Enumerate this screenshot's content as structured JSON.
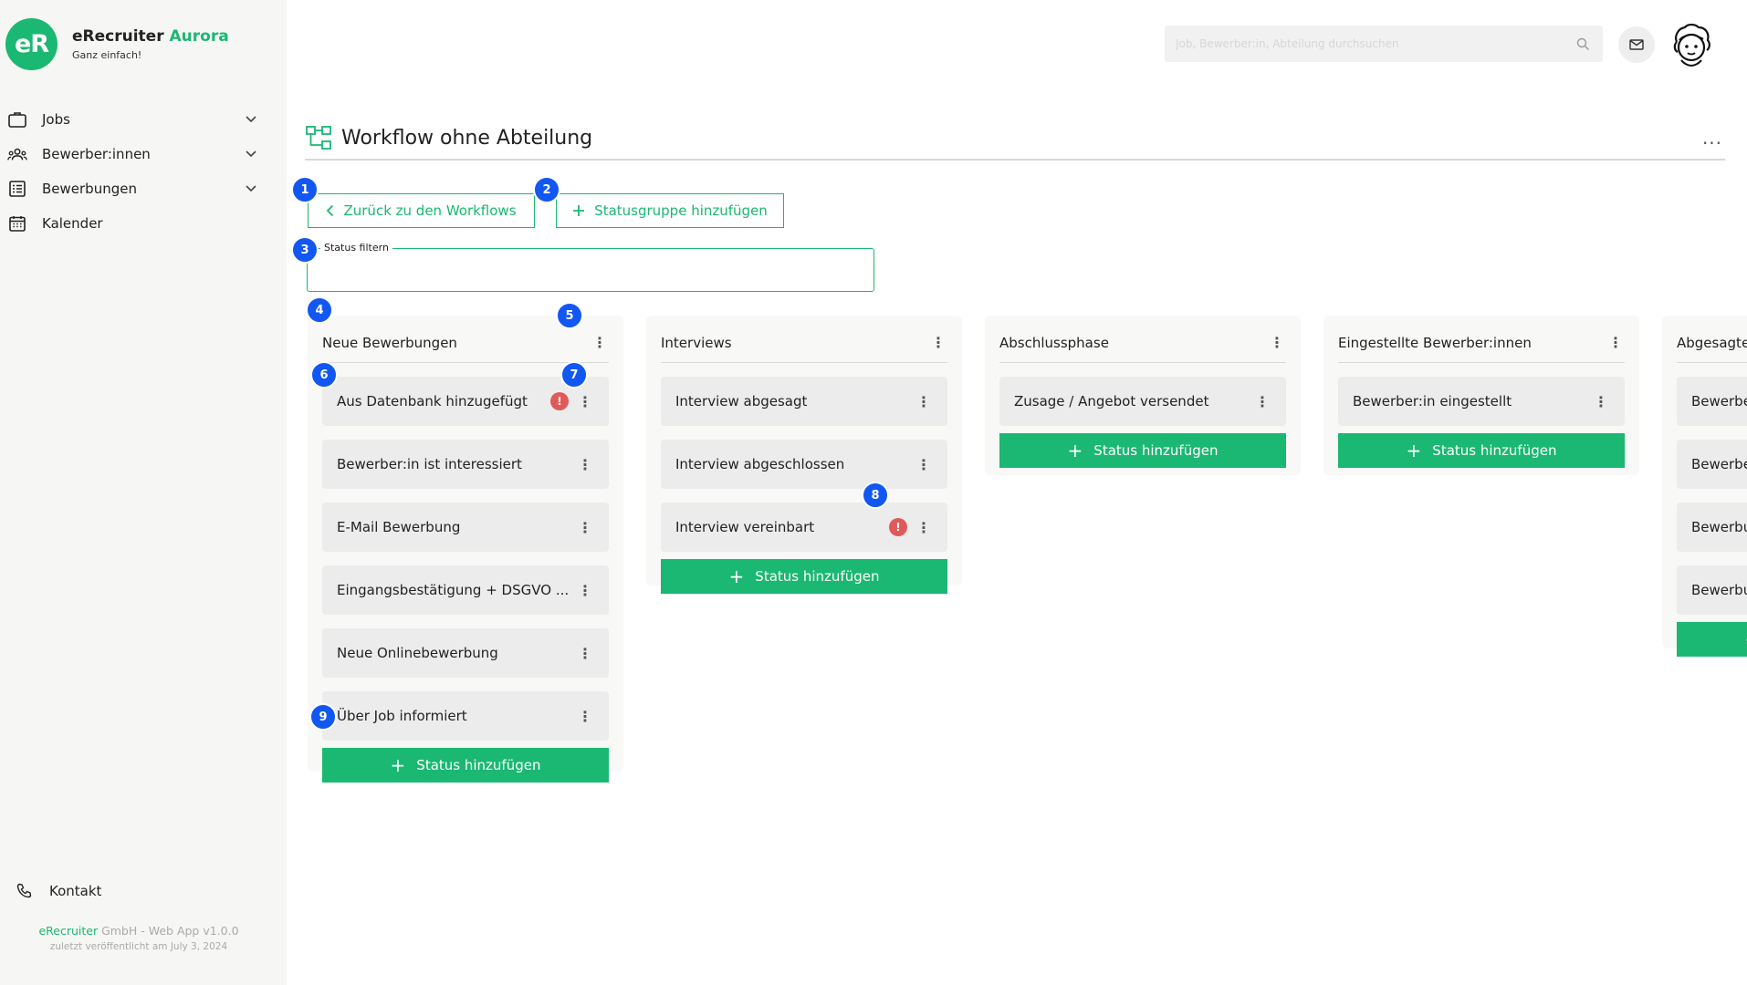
{
  "brand": {
    "logo_text": "eR",
    "name": "eRecruiter",
    "name_accent": "Aurora",
    "tagline": "Ganz einfach!",
    "accent_color": "#1ab872"
  },
  "sidebar": {
    "items": [
      {
        "label": "Jobs",
        "icon": "briefcase-icon",
        "has_chevron": true
      },
      {
        "label": "Bewerber:innen",
        "icon": "people-icon",
        "has_chevron": true
      },
      {
        "label": "Bewerbungen",
        "icon": "list-icon",
        "has_chevron": true
      },
      {
        "label": "Kalender",
        "icon": "calendar-icon",
        "has_chevron": false
      }
    ],
    "contact_label": "Kontakt",
    "footer_company": "eRecruiter",
    "footer_rest": " GmbH - Web App v1.0.0",
    "footer_published": "zuletzt veröffentlicht am July 3, 2024"
  },
  "topbar": {
    "search_placeholder": "Job, Bewerber:in, Abteilung durchsuchen"
  },
  "page": {
    "title": "Workflow ohne Abteilung",
    "more": "..."
  },
  "actions": {
    "back_label": "Zurück zu den Workflows",
    "add_group_label": "Statusgruppe hinzufügen"
  },
  "filter": {
    "legend": "Status filtern",
    "value": ""
  },
  "add_status_label": "Status hinzufügen",
  "columns": [
    {
      "title": "Neue Bewerbungen",
      "statuses": [
        {
          "label": "Aus Datenbank hinzugefügt",
          "warning": true
        },
        {
          "label": "Bewerber:in ist interessiert",
          "warning": false
        },
        {
          "label": "E-Mail Bewerbung",
          "warning": false
        },
        {
          "label": "Eingangsbestätigung + DSGVO ...",
          "warning": false
        },
        {
          "label": "Neue Onlinebewerbung",
          "warning": false
        },
        {
          "label": "Über Job informiert",
          "warning": false
        }
      ]
    },
    {
      "title": "Interviews",
      "statuses": [
        {
          "label": "Interview abgesagt",
          "warning": false
        },
        {
          "label": "Interview abgeschlossen",
          "warning": false
        },
        {
          "label": "Interview vereinbart",
          "warning": true
        }
      ]
    },
    {
      "title": "Abschlussphase",
      "statuses": [
        {
          "label": "Zusage / Angebot versendet",
          "warning": false
        }
      ]
    },
    {
      "title": "Eingestellte Bewerber:innen",
      "statuses": [
        {
          "label": "Bewerber:in eingestellt",
          "warning": false
        }
      ]
    },
    {
      "title": "Abgesagte Bewerber:innen",
      "statuses": [
        {
          "label": "Bewerber:in abgesagt",
          "warning": false
        },
        {
          "label": "Bewerber:in hat abgesagt",
          "warning": false
        },
        {
          "label": "Bewerbung abgelehnt",
          "warning": false
        },
        {
          "label": "Bewerbung zurückgezogen",
          "warning": false
        }
      ]
    }
  ],
  "markers": [
    "1",
    "2",
    "3",
    "4",
    "5",
    "6",
    "7",
    "8",
    "9"
  ]
}
